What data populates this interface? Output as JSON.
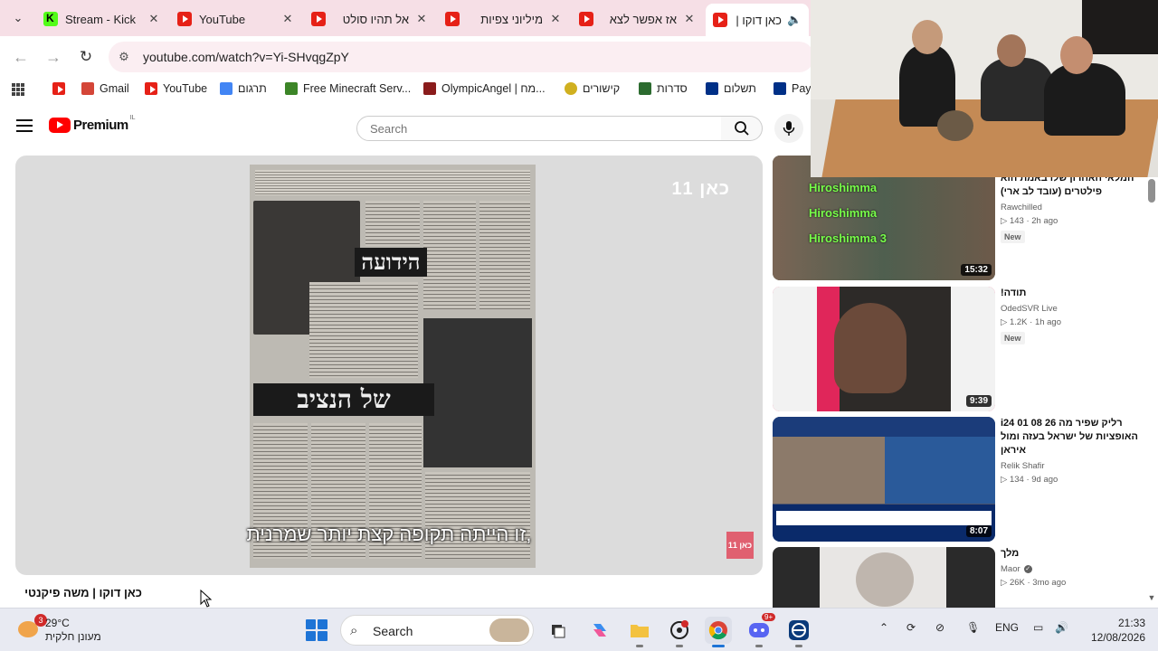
{
  "browser": {
    "tabs": [
      {
        "title": "Stream - Kick",
        "favicon": "kick-icon"
      },
      {
        "title": "YouTube",
        "favicon": "youtube-icon"
      },
      {
        "title": "אל תהיו סולט",
        "favicon": "youtube-icon"
      },
      {
        "title": "מיליוני צפיות",
        "favicon": "youtube-icon"
      },
      {
        "title": "אז אפשר לצא",
        "favicon": "youtube-icon"
      },
      {
        "title": "כאן דוקו |",
        "favicon": "youtube-icon"
      }
    ],
    "url": "youtube.com/watch?v=Yi-SHvqgZpY",
    "bookmarks": [
      {
        "label": "",
        "icon": "youtube-icon",
        "color": "#e62117"
      },
      {
        "label": "Gmail",
        "icon": "gmail-icon",
        "color": "#d44638"
      },
      {
        "label": "YouTube",
        "icon": "youtube-icon",
        "color": "#e62117"
      },
      {
        "label": "תרגום",
        "icon": "translate-icon",
        "color": "#4285f4"
      },
      {
        "label": "Free Minecraft Serv...",
        "icon": "minecraft-icon",
        "color": "#3c8527"
      },
      {
        "label": "OlympicAngel | מח...",
        "icon": "olympic-icon",
        "color": "#8a1c1c"
      },
      {
        "label": "קישורים",
        "icon": "star-icon",
        "color": "#d0b020"
      },
      {
        "label": "סדרות",
        "icon": "series-icon",
        "color": "#2c6b2f"
      },
      {
        "label": "תשלום",
        "icon": "paypal-icon",
        "color": "#003087"
      },
      {
        "label": "PayP",
        "icon": "paypal-icon",
        "color": "#003087"
      }
    ]
  },
  "youtube": {
    "logo_text": "Premium",
    "country": "IL",
    "search_placeholder": "Search",
    "player": {
      "watermark": "כאן 11",
      "headline1": "הידועה",
      "headline2": "של הנציב",
      "subtitle": "זו הייתה תקופה קצת יותר שמרנית,",
      "badge": "כאן 11"
    },
    "video_title": "כאן דוקו | משה פיקנטי",
    "recommendations": [
      {
        "title": "המלאי האחרון שלו באמת הוא פילטרים (עובד לב ארי)",
        "channel": "Rawchilled",
        "verified": false,
        "stats": "143 · 2h ago",
        "badge": "New",
        "duration": "15:32",
        "thumb_color": "#5a6a5a"
      },
      {
        "title": "תודה!",
        "channel": "OdedSVR Live",
        "verified": false,
        "stats": "1.2K · 1h ago",
        "badge": "New",
        "duration": "9:39",
        "thumb_color": "#e0265a"
      },
      {
        "title": "רליק שפיר  מה 26 08 01  i24 האופציות של ישראל בעזה ומול איראן",
        "channel": "Relik Shafir",
        "verified": false,
        "stats": "134 · 9d ago",
        "badge": "",
        "duration": "8:07",
        "thumb_color": "#3a5e8c"
      },
      {
        "title": "מלך",
        "channel": "Maor",
        "verified": true,
        "stats": "26K · 3mo ago",
        "badge": "",
        "duration": "",
        "thumb_color": "#2a2a2a"
      }
    ]
  },
  "taskbar": {
    "weather_temp": "29°C",
    "weather_desc": "מעונן חלקית",
    "weather_badge": "3",
    "search_label": "Search",
    "language": "ENG",
    "time": "21:33",
    "date": "12/08/2026",
    "discord_badge": "9+"
  }
}
